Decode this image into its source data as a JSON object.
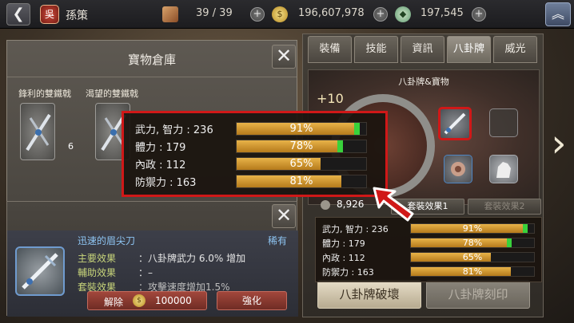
{
  "header": {
    "faction": "吳",
    "name": "孫策",
    "scrolls": "39 / 39",
    "gold": "196,607,978",
    "jade": "197,545"
  },
  "warehouse": {
    "title": "寶物倉庫",
    "items": [
      {
        "label": "鋒利的雙鐵戟",
        "count": "6"
      },
      {
        "label": "渴望的雙鐵戟",
        "count": ""
      }
    ]
  },
  "detail": {
    "name": "迅速的眉尖刀",
    "rarity": "稀有",
    "rows": [
      {
        "key": "主要效果",
        "value": "：八卦牌武力 6.0% 增加"
      },
      {
        "key": "輔助效果",
        "value": "：–"
      },
      {
        "key": "套裝效果",
        "value": "：攻擊速度增加1.5%"
      }
    ],
    "dismantle_label": "解除",
    "dismantle_cost": "100000",
    "enhance_label": "強化"
  },
  "tabs": [
    "裝備",
    "技能",
    "資訊",
    "八卦牌",
    "威光"
  ],
  "active_tab": 3,
  "bagua": {
    "title": "八卦牌&寶物",
    "level": "+10",
    "score": "8,926",
    "set_buttons": [
      "套裝效果1",
      "套裝效果2"
    ],
    "destroy_label": "八卦牌破壞",
    "engrave_label": "八卦牌刻印"
  },
  "stats": [
    {
      "label": "武力, 智力 : 236",
      "pct": "91%",
      "fill": 0.91,
      "green": 0.04
    },
    {
      "label": "體力 : 179",
      "pct": "78%",
      "fill": 0.78,
      "green": 0.04
    },
    {
      "label": "內政 : 112",
      "pct": "65%",
      "fill": 0.65,
      "green": 0
    },
    {
      "label": "防禦力 : 163",
      "pct": "81%",
      "fill": 0.81,
      "green": 0
    }
  ],
  "colors": {
    "highlight": "#d01818",
    "bar_fill": "#d99a2b",
    "bar_bonus": "#39d23b",
    "rare_text": "#8ec5f3",
    "effect_key": "#c7d47a"
  },
  "icons": {
    "back": "back-arrow-icon",
    "home": "home-chevron-icon",
    "scroll": "scroll-icon",
    "gold": "gold-coin-icon",
    "jade": "jade-icon",
    "next": "next-arrow-icon"
  }
}
